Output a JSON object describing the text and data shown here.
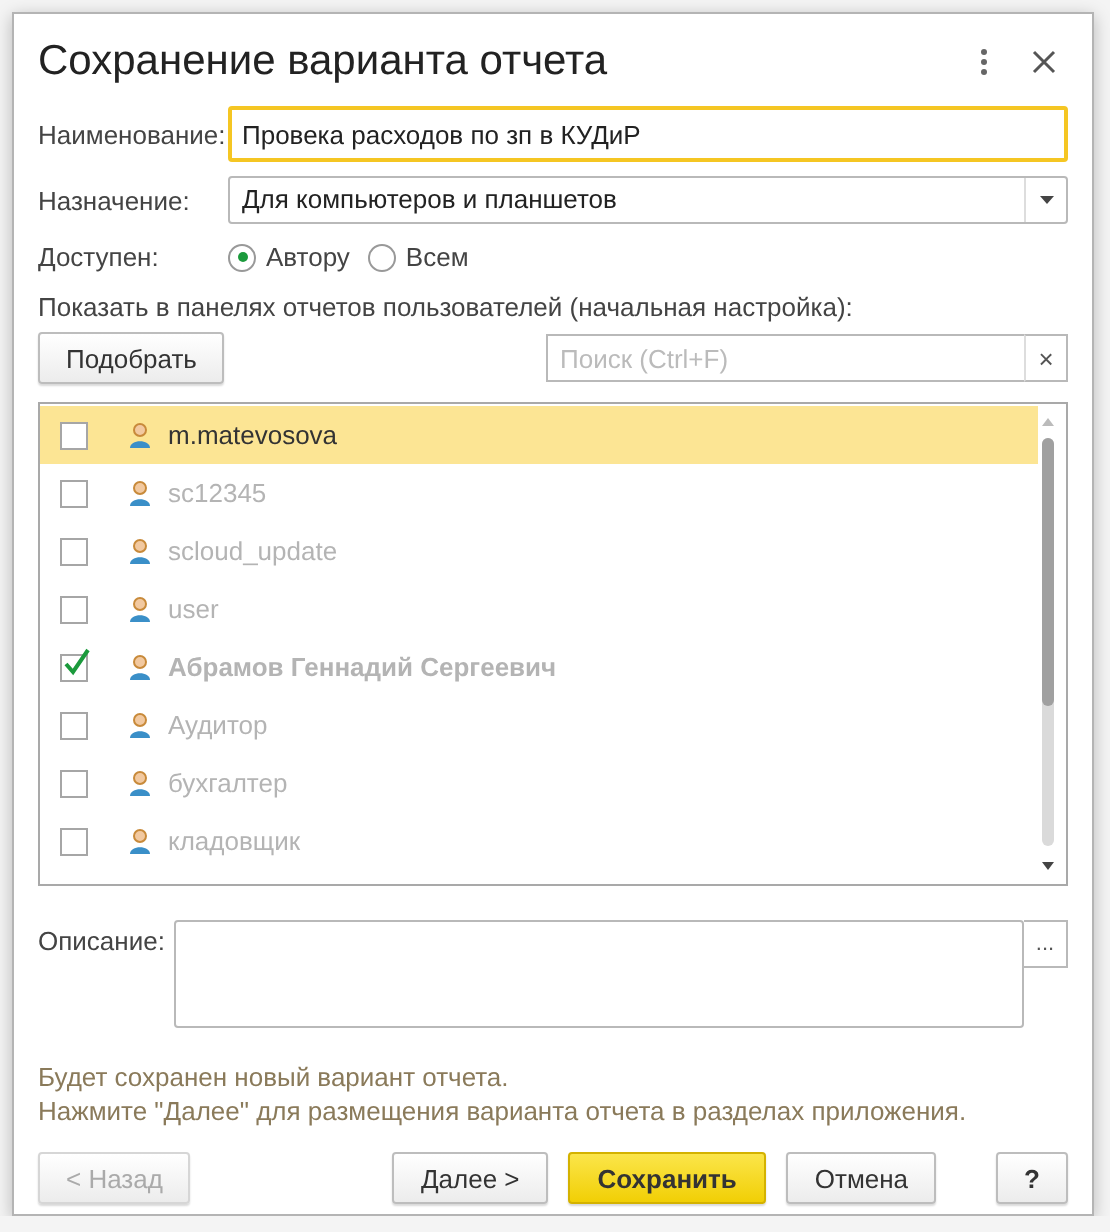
{
  "window": {
    "title": "Сохранение варианта отчета"
  },
  "fields": {
    "name": {
      "label": "Наименование:",
      "value": "Провека расходов по зп в КУДиР"
    },
    "purpose": {
      "label": "Назначение:",
      "value": "Для компьютеров и планшетов"
    }
  },
  "available": {
    "label": "Доступен:",
    "options": [
      {
        "label": "Автору",
        "selected": true
      },
      {
        "label": "Всем",
        "selected": false
      }
    ]
  },
  "panels_label": "Показать в панелях отчетов пользователей (начальная настройка):",
  "pick_button": "Подобрать",
  "search": {
    "placeholder": "Поиск (Ctrl+F)",
    "clear": "×"
  },
  "users": [
    {
      "name": "m.matevosova",
      "checked": false,
      "selected": true,
      "disabled": false
    },
    {
      "name": "sc12345",
      "checked": false,
      "selected": false,
      "disabled": true
    },
    {
      "name": "scloud_update",
      "checked": false,
      "selected": false,
      "disabled": true
    },
    {
      "name": "user",
      "checked": false,
      "selected": false,
      "disabled": true
    },
    {
      "name": "Абрамов Геннадий Сергеевич",
      "checked": true,
      "selected": false,
      "disabled": true
    },
    {
      "name": "Аудитор",
      "checked": false,
      "selected": false,
      "disabled": true
    },
    {
      "name": "бухгалтер",
      "checked": false,
      "selected": false,
      "disabled": true
    },
    {
      "name": "кладовщик",
      "checked": false,
      "selected": false,
      "disabled": true
    }
  ],
  "description": {
    "label": "Описание:",
    "more": "..."
  },
  "info": [
    "Будет сохранен новый вариант отчета.",
    "Нажмите \"Далее\" для размещения варианта отчета в разделах приложения."
  ],
  "buttons": [
    {
      "label": "< Назад",
      "kind": "default",
      "disabled": true
    },
    {
      "label": "Далее >",
      "kind": "default",
      "disabled": false
    },
    {
      "label": "Сохранить",
      "kind": "primary",
      "disabled": false
    },
    {
      "label": "Отмена",
      "kind": "default",
      "disabled": false
    },
    {
      "label": "?",
      "kind": "help",
      "disabled": false
    }
  ]
}
